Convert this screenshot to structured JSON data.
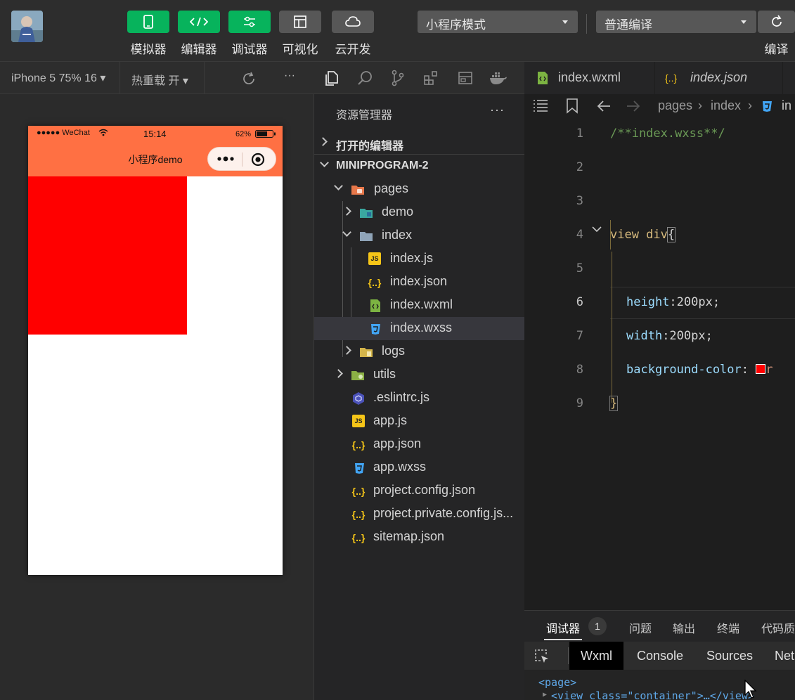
{
  "toolbar": {
    "buttons": [
      {
        "label": "模拟器",
        "icon": "phone-icon"
      },
      {
        "label": "编辑器",
        "icon": "code-icon"
      },
      {
        "label": "调试器",
        "icon": "sliders-icon"
      },
      {
        "label": "可视化",
        "icon": "layout-icon"
      },
      {
        "label": "云开发",
        "icon": "cloud-icon"
      }
    ],
    "mode_select": "小程序模式",
    "compile_select": "普通编译",
    "compile_label": "编译"
  },
  "simulator": {
    "device": "iPhone 5 75% 16",
    "hot_reload": "热重载 开",
    "more": "···",
    "status": {
      "carrier": "●●●●● WeChat",
      "time": "15:14",
      "battery": "62%"
    },
    "nav_title": "小程序demo",
    "box_color": "#ff0000",
    "nav_color": "#ff7043"
  },
  "explorer": {
    "title": "资源管理器",
    "more": "···",
    "open_editors": "打开的编辑器",
    "project": "MINIPROGRAM-2",
    "files": {
      "pages": "pages",
      "demo": "demo",
      "index": "index",
      "index_js": "index.js",
      "index_json": "index.json",
      "index_wxml": "index.wxml",
      "index_wxss": "index.wxss",
      "logs": "logs",
      "utils": "utils",
      "eslintrc": ".eslintrc.js",
      "app_js": "app.js",
      "app_json": "app.json",
      "app_wxss": "app.wxss",
      "project_config": "project.config.json",
      "project_private": "project.private.config.js...",
      "sitemap": "sitemap.json"
    },
    "icons": {
      "js": "JS",
      "json": "{..}",
      "css": "3"
    }
  },
  "editor": {
    "tabs": [
      {
        "label": "index.wxml"
      },
      {
        "label": "index.json"
      }
    ],
    "breadcrumb": {
      "a": "pages",
      "b": "index",
      "c": "in"
    },
    "line_numbers": [
      "1",
      "2",
      "3",
      "4",
      "5",
      "6",
      "7",
      "8",
      "9"
    ],
    "code": {
      "l1": "/**index.wxss**/",
      "l4_sel": "view div",
      "l4_brace": "{",
      "l6_prop": "height",
      "l6_val": ":200px;",
      "l7_prop": "width",
      "l7_val": ":200px;",
      "l8_prop": "background-color",
      "l8_colon": ":",
      "l8_val": "r",
      "l9": "}"
    },
    "swatch_color": "#ff0000"
  },
  "debugger": {
    "tabs": [
      "调试器",
      "问题",
      "输出",
      "终端",
      "代码质"
    ],
    "badge": "1",
    "subtabs": [
      "Wxml",
      "Console",
      "Sources",
      "Net"
    ],
    "dom_line1": "<page>",
    "dom_line2": "<view class=\"container\">…</view>"
  }
}
